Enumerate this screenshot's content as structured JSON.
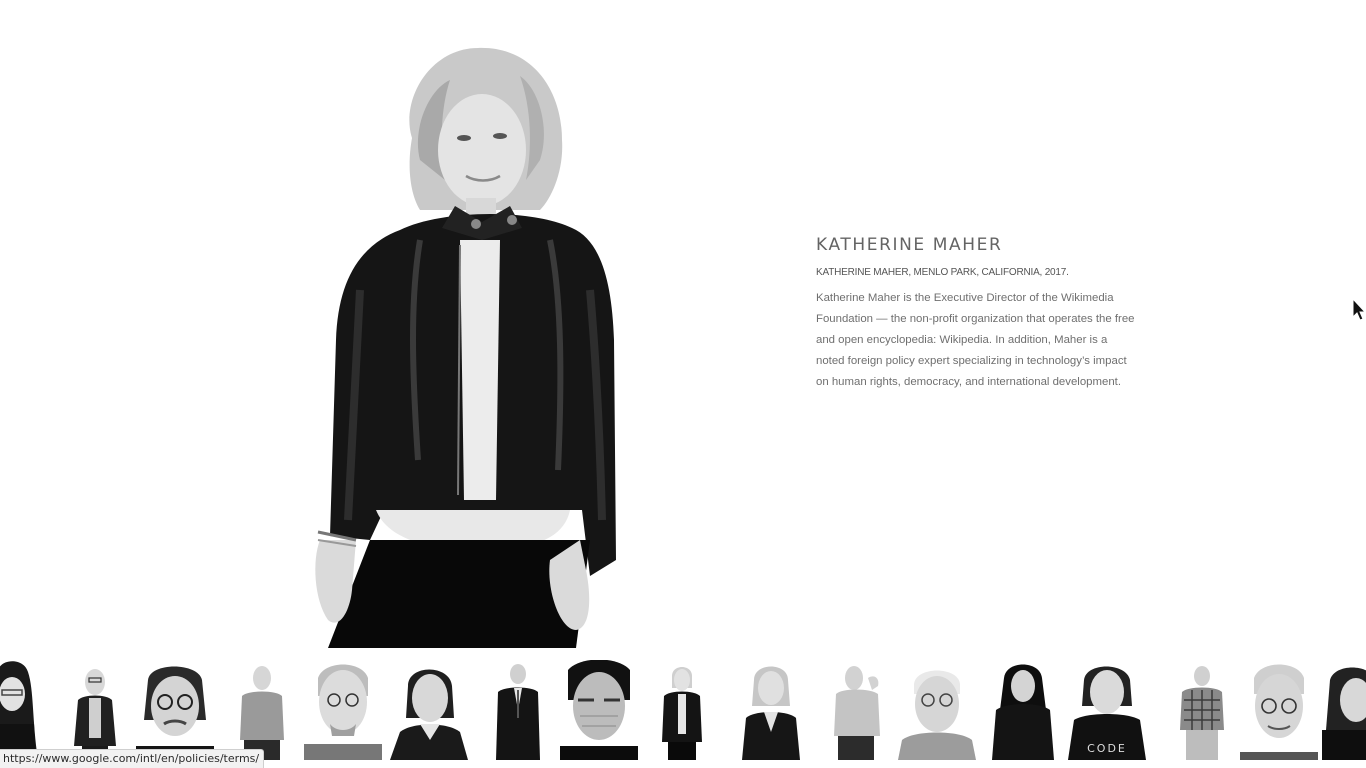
{
  "feature": {
    "name": "KATHERINE MAHER",
    "caption": "KATHERINE MAHER, MENLO PARK, CALIFORNIA, 2017.",
    "description": "Katherine Maher is the Executive Director of the Wikimedia Foundation — the non-profit organization that operates the free and open encyclopedia: Wikipedia. In addition, Maher is a noted foreign policy expert specializing in technology’s impact on human rights, democracy, and international development."
  },
  "thumbnails": [
    {
      "id": "portrait-1"
    },
    {
      "id": "portrait-2"
    },
    {
      "id": "portrait-3"
    },
    {
      "id": "portrait-4"
    },
    {
      "id": "portrait-5"
    },
    {
      "id": "portrait-6"
    },
    {
      "id": "portrait-7"
    },
    {
      "id": "portrait-8"
    },
    {
      "id": "portrait-9"
    },
    {
      "id": "portrait-10"
    },
    {
      "id": "portrait-11"
    },
    {
      "id": "portrait-12"
    },
    {
      "id": "portrait-13"
    },
    {
      "id": "portrait-14"
    },
    {
      "id": "portrait-15"
    },
    {
      "id": "portrait-16"
    },
    {
      "id": "portrait-17"
    }
  ],
  "thumb_shirt_text": "CODE",
  "status_bar": {
    "url": "https://www.google.com/intl/en/policies/terms/"
  },
  "colors": {
    "background": "#ffffff",
    "text": "#6f6f6f",
    "status_bar_bg": "#f2f2f2"
  }
}
